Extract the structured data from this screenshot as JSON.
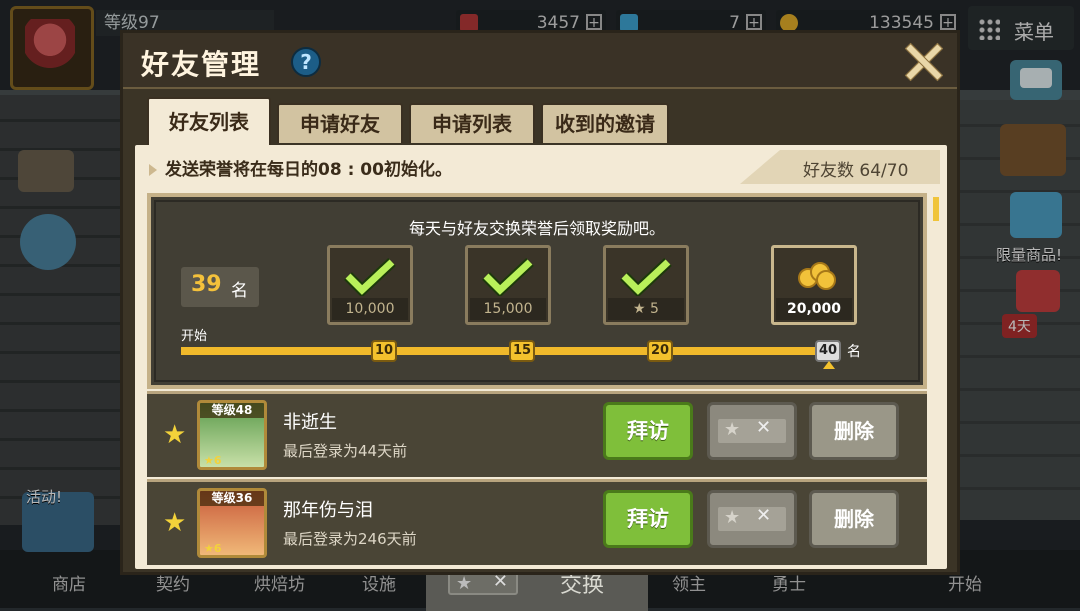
{
  "hud": {
    "level_label": "等级97",
    "resource1": "3457",
    "resource2": "7",
    "resource3": "133545",
    "menu_label": "菜单",
    "shop_label": "限量商品!",
    "timer_label": "4天",
    "event_label": "活动!"
  },
  "bottom_nav": [
    "商店",
    "契约",
    "烘焙坊",
    "设施",
    "领主",
    "勇士",
    "开始"
  ],
  "exchange_bar": {
    "label": "交换"
  },
  "dialog": {
    "title": "好友管理",
    "help": "?",
    "tabs": [
      {
        "label": "好友列表",
        "active": true
      },
      {
        "label": "申请好友",
        "active": false
      },
      {
        "label": "申请列表",
        "active": false
      },
      {
        "label": "收到的邀请",
        "active": false
      }
    ],
    "reset_notice": "发送荣誉将在每日的08 : 00初始化。",
    "friend_count": "好友数 64/70",
    "reward": {
      "description": "每天与好友交换荣誉后领取奖励吧。",
      "rank_value": "39",
      "rank_unit": "名",
      "items": [
        {
          "amount": "10,000",
          "claimed": true,
          "milestone": "10"
        },
        {
          "amount": "15,000",
          "claimed": true,
          "milestone": "15"
        },
        {
          "amount": "5",
          "claimed": true,
          "milestone": "20"
        },
        {
          "amount": "20,000",
          "claimed": false,
          "milestone": "40"
        }
      ],
      "start_label": "开始",
      "end_unit": "名",
      "progress_fraction": 1.0
    },
    "friends": [
      {
        "level": "等级48",
        "stars": "6",
        "name": "非逝生",
        "last_login": "最后登录为44天前",
        "visit": "拜访",
        "delete": "删除"
      },
      {
        "level": "等级36",
        "stars": "6",
        "name": "那年伤与泪",
        "last_login": "最后登录为246天前",
        "visit": "拜访",
        "delete": "删除"
      }
    ]
  },
  "colors": {
    "accent_gold": "#f3c12d",
    "visit_green": "#7fbf3a",
    "panel_bg": "#f3ead6"
  }
}
